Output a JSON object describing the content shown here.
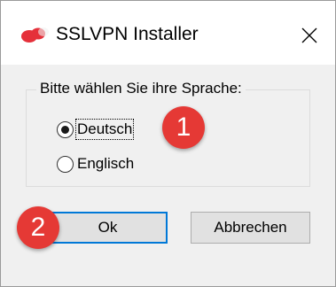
{
  "window": {
    "title": "SSLVPN Installer",
    "close_label": "✕"
  },
  "language_group": {
    "label": "Bitte wählen Sie ihre Sprache:",
    "options": [
      {
        "label": "Deutsch",
        "checked": true
      },
      {
        "label": "Englisch",
        "checked": false
      }
    ]
  },
  "buttons": {
    "ok": "Ok",
    "cancel": "Abbrechen"
  },
  "callouts": [
    "1",
    "2"
  ],
  "colors": {
    "badge": "#e53935",
    "default_button_border": "#0078d7",
    "logo": "#e5303a"
  }
}
